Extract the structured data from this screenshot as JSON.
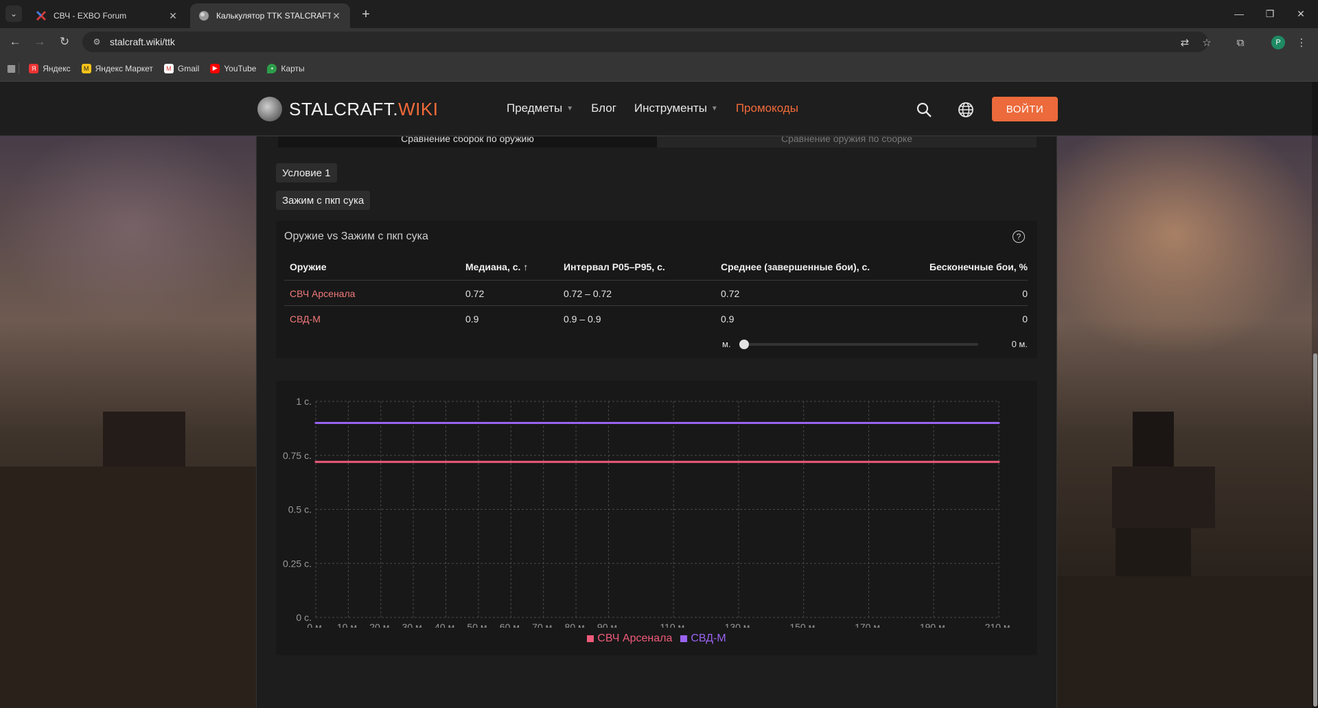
{
  "browser": {
    "tabs": [
      {
        "title": "СВЧ - EXBO Forum",
        "active": false
      },
      {
        "title": "Калькулятор TTK STALCRAFT: X",
        "active": true
      }
    ],
    "url": "stalcraft.wiki/ttk",
    "profile_initial": "P",
    "bookmarks": [
      "Яндекс",
      "Яндекс Маркет",
      "Gmail",
      "YouTube",
      "Карты"
    ]
  },
  "site": {
    "logo_main": "STALCRAFT.",
    "logo_accent": "WIKI",
    "nav": [
      {
        "label": "Предметы",
        "dropdown": true
      },
      {
        "label": "Блог",
        "dropdown": false
      },
      {
        "label": "Инструменты",
        "dropdown": true
      },
      {
        "label": "Промокоды",
        "dropdown": false,
        "highlight": true
      }
    ],
    "login_label": "ВОЙТИ",
    "accent_color": "#ec6a3b"
  },
  "calculator": {
    "subtabs": [
      "Сравнение сборок по оружию",
      "Сравнение оружия по сборке"
    ],
    "condition_chip": "Условие 1",
    "preset_chip": "Зажим с пкп сука",
    "table": {
      "title": "Оружие vs Зажим с пкп сука",
      "headers": [
        "Оружие",
        "Медиана, с. ↑",
        "Интервал P05–P95, с.",
        "Среднее (завершенные бои), с.",
        "Бесконечные бои, %"
      ],
      "rows": [
        {
          "weapon": "СВЧ Арсенала",
          "median": "0.72",
          "interval": "0.72 – 0.72",
          "mean": "0.72",
          "infinite": "0"
        },
        {
          "weapon": "СВД-М",
          "median": "0.9",
          "interval": "0.9 – 0.9",
          "mean": "0.9",
          "infinite": "0"
        }
      ],
      "distance_min_label": "м.",
      "distance_value_label": "0 м.",
      "distance_value": 0
    }
  },
  "chart_data": {
    "type": "line",
    "x": [
      0,
      10,
      20,
      30,
      40,
      50,
      60,
      70,
      80,
      90,
      110,
      130,
      150,
      170,
      190,
      210
    ],
    "x_tick_labels": [
      "0 м.",
      "10 м.",
      "20 м.",
      "30 м.",
      "40 м.",
      "50 м.",
      "60 м.",
      "70 м.",
      "80 м.",
      "90 м.",
      "110 м.",
      "130 м.",
      "150 м.",
      "170 м.",
      "190 м.",
      "210 м."
    ],
    "y_ticks": [
      0,
      0.25,
      0.5,
      0.75,
      1
    ],
    "y_tick_labels": [
      "0 с.",
      "0.25 с.",
      "0.5 с.",
      "0.75 с.",
      "1 с."
    ],
    "ylim": [
      0,
      1
    ],
    "xlim": [
      0,
      210
    ],
    "grid": true,
    "legend_position": "bottom-center",
    "series": [
      {
        "name": "СВЧ Арсенала",
        "color": "#ef5b7a",
        "values": [
          0.72,
          0.72,
          0.72,
          0.72,
          0.72,
          0.72,
          0.72,
          0.72,
          0.72,
          0.72,
          0.72,
          0.72,
          0.72,
          0.72,
          0.72,
          0.72
        ]
      },
      {
        "name": "СВД-М",
        "color": "#9a63f0",
        "values": [
          0.9,
          0.9,
          0.9,
          0.9,
          0.9,
          0.9,
          0.9,
          0.9,
          0.9,
          0.9,
          0.9,
          0.9,
          0.9,
          0.9,
          0.9,
          0.9
        ]
      }
    ]
  }
}
